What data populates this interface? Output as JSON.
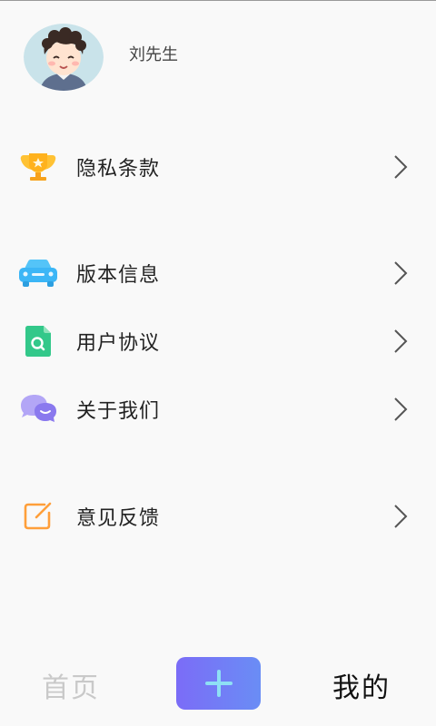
{
  "profile": {
    "name": "刘先生"
  },
  "menu": [
    {
      "label": "隐私条款",
      "icon": "trophy-icon"
    },
    {
      "label": "版本信息",
      "icon": "car-icon"
    },
    {
      "label": "用户协议",
      "icon": "document-search-icon"
    },
    {
      "label": "关于我们",
      "icon": "chat-bubbles-icon"
    },
    {
      "label": "意见反馈",
      "icon": "edit-square-icon"
    }
  ],
  "tabbar": {
    "home": "首页",
    "mine": "我的"
  },
  "colors": {
    "background": "#f9f9f9",
    "accent_start": "#7b6cf7",
    "accent_end": "#6a8df5",
    "trophy": "#ffb21d",
    "car": "#3cb6f6",
    "doc": "#33c88a",
    "chat": "#9c8cf3",
    "edit": "#ff9f3a"
  }
}
